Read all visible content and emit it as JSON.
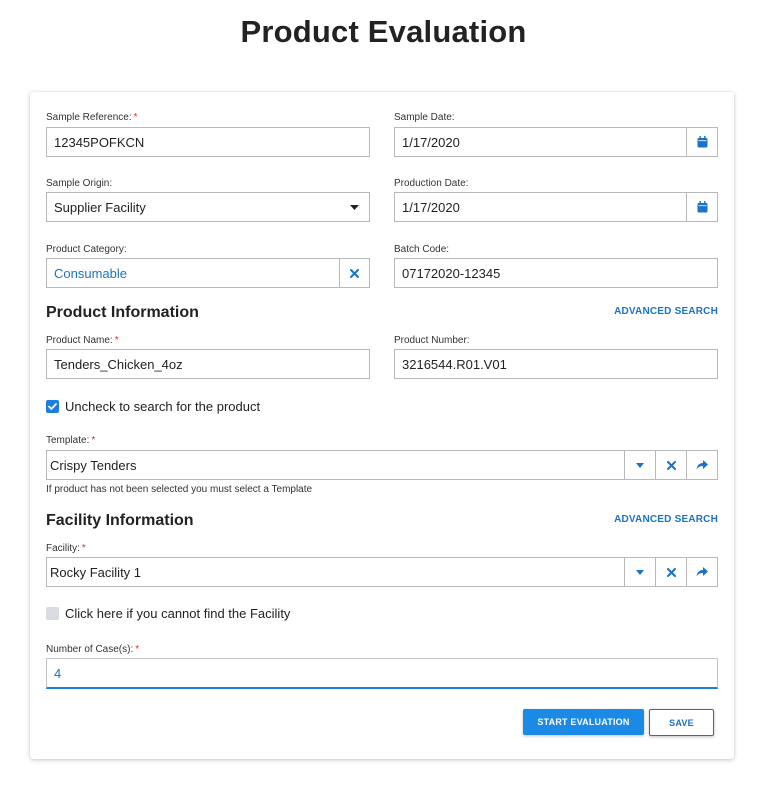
{
  "page": {
    "title": "Product Evaluation"
  },
  "colors": {
    "accent": "#1a8ae6",
    "link": "#1a73c8",
    "required": "#d93025"
  },
  "form": {
    "sample_reference": {
      "label": "Sample Reference:",
      "required_mark": "*",
      "value": "12345POFKCN"
    },
    "sample_date": {
      "label": "Sample Date:",
      "value": "1/17/2020",
      "icon": "calendar-icon"
    },
    "sample_origin": {
      "label": "Sample Origin:",
      "value": "Supplier Facility",
      "icon": "caret-down-icon"
    },
    "production_date": {
      "label": "Production Date:",
      "value": "1/17/2020",
      "icon": "calendar-icon"
    },
    "product_category": {
      "label": "Product Category:",
      "value": "Consumable",
      "icon": "clear-icon"
    },
    "batch_code": {
      "label": "Batch Code:",
      "value": "07172020-12345"
    }
  },
  "product_info": {
    "title": "Product Information",
    "advanced_search": "ADVANCED SEARCH",
    "product_name": {
      "label": "Product Name:",
      "required_mark": "*",
      "value": "Tenders_Chicken_4oz"
    },
    "product_number": {
      "label": "Product Number:",
      "value": "3216544.R01.V01"
    },
    "search_checkbox": {
      "label": "Uncheck to search for the product",
      "checked": true
    },
    "template": {
      "label": "Template:",
      "required_mark": "*",
      "value": "Crispy Tenders"
    },
    "template_help": "If product has not been selected you must select a Template"
  },
  "facility_info": {
    "title": "Facility Information",
    "advanced_search": "ADVANCED SEARCH",
    "facility": {
      "label": "Facility:",
      "required_mark": "*",
      "value": "Rocky Facility 1"
    },
    "cannot_find_checkbox": {
      "label": "Click here if you cannot find the Facility",
      "checked": false
    },
    "cases": {
      "label": "Number of Case(s):",
      "required_mark": "*",
      "value": "4"
    }
  },
  "actions": {
    "start_label": "START EVALUATION",
    "save_label": "SAVE"
  }
}
